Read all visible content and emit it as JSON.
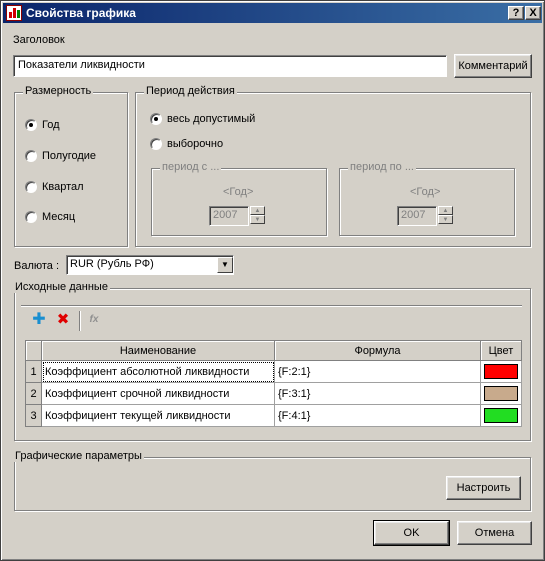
{
  "window": {
    "title": "Свойства графика",
    "help_label": "?",
    "close_label": "X"
  },
  "header_section": {
    "label": "Заголовок",
    "title_value": "Показатели ликвидности",
    "comment_button": "Комментарий"
  },
  "dimension": {
    "legend": "Размерность",
    "options": [
      "Год",
      "Полугодие",
      "Квартал",
      "Месяц"
    ],
    "selected": "Год"
  },
  "period": {
    "legend": "Период действия",
    "options": [
      "весь допустимый",
      "выборочно"
    ],
    "selected": "весь допустимый",
    "from": {
      "legend": "период с ...",
      "unit": "<Год>",
      "value": "2007"
    },
    "to": {
      "legend": "период по ...",
      "unit": "<Год>",
      "value": "2007"
    }
  },
  "currency": {
    "label": "Валюта :",
    "value": "RUR (Рубль РФ)"
  },
  "source_data": {
    "legend": "Исходные данные",
    "toolbar": [
      "add-icon",
      "delete-icon",
      "formula-icon"
    ],
    "columns": [
      "Наименование",
      "Формула",
      "Цвет"
    ],
    "rows": [
      {
        "num": "1",
        "name": "Коэффициент абсолютной ликвидности",
        "formula": "{F:2:1}",
        "color": "#ff0000"
      },
      {
        "num": "2",
        "name": "Коэффициент срочной ликвидности",
        "formula": "{F:3:1}",
        "color": "#c8aa8c"
      },
      {
        "num": "3",
        "name": "Коэффициент текущей ликвидности",
        "formula": "{F:4:1}",
        "color": "#22dd22"
      }
    ]
  },
  "graphic_params": {
    "legend": "Графические параметры",
    "configure_button": "Настроить"
  },
  "footer": {
    "ok_button": "OK",
    "cancel_button": "Отмена"
  }
}
